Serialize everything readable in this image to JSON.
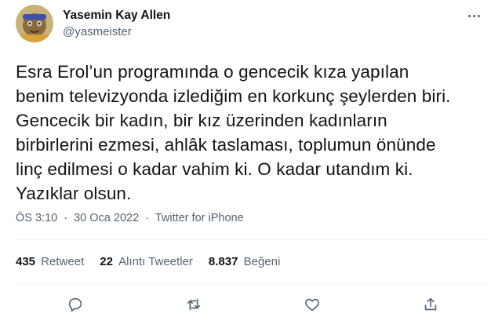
{
  "user": {
    "display_name": "Yasemin Kay Allen",
    "handle": "@yasmeister",
    "avatar_icon": "avatar-photo"
  },
  "tweet": {
    "text": "Esra Erol’un programında o gencecik kıza yapılan\nbenim televizyonda izlediğim en korkunç şeylerden biri.\nGencecik bir kadın, bir kız üzerinden kadınların\nbirbirlerini ezmesi, ahlâk taslaması, toplumun önünde\nlinç edilmesi o kadar vahim ki. O kadar utandım ki.\nYazıklar olsun.",
    "time": "ÖS 3:10",
    "date": "30 Oca 2022",
    "separator": "·",
    "source": "Twitter for iPhone"
  },
  "stats": {
    "retweets_count": "435",
    "retweets_label": "Retweet",
    "quotes_count": "22",
    "quotes_label": "Alıntı Tweetler",
    "likes_count": "8.837",
    "likes_label": "Beğeni"
  },
  "colors": {
    "text": "#0f1419",
    "secondary": "#536471",
    "divider": "#eff3f4"
  },
  "icons": [
    "more-icon",
    "reply-icon",
    "retweet-icon",
    "like-icon",
    "share-icon"
  ]
}
